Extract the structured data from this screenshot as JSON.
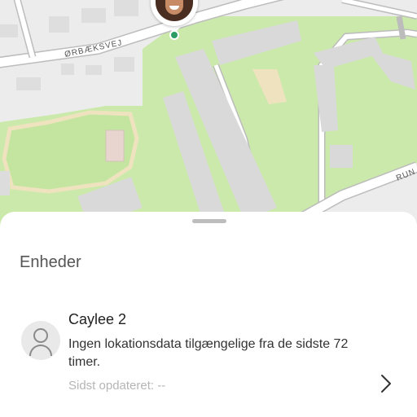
{
  "map": {
    "street_labels": [
      "ØRBÆKSVEJ",
      "RUN"
    ],
    "colors": {
      "park": "#cbe9ab",
      "road": "#ffffff",
      "road_edge": "#bcbcbc",
      "building": "#d9d9d9",
      "path": "#eee4c6"
    }
  },
  "pin": {
    "location_dot_color": "#2d9c62",
    "icon": "person-photo"
  },
  "sheet": {
    "handle_icon": "drag-handle",
    "title": "Enheder",
    "devices": [
      {
        "name": "Caylee 2",
        "status": "Ingen lokationsdata tilgængelige fra de sidste 72 timer.",
        "updated": "Sidst opdateret: --",
        "avatar_icon": "person-icon",
        "action_icon": "chevron-right-icon"
      }
    ]
  }
}
